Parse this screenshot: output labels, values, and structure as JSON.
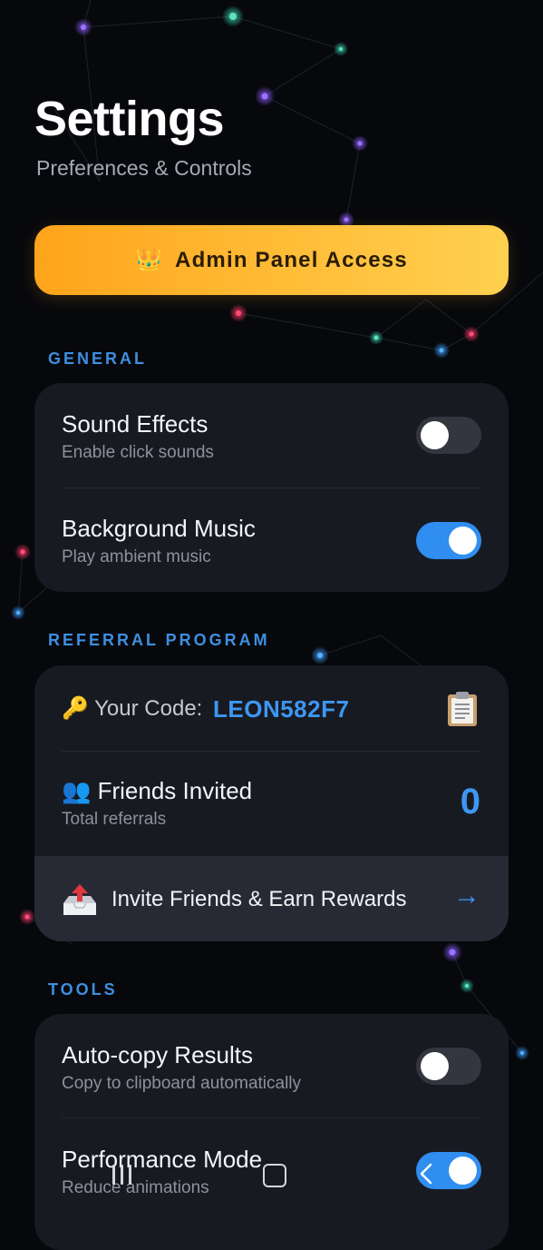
{
  "header": {
    "title": "Settings",
    "subtitle": "Preferences & Controls"
  },
  "admin": {
    "icon": "crown-icon",
    "emoji": "👑",
    "label": "Admin Panel Access"
  },
  "sections": {
    "general": "GENERAL",
    "referral": "REFERRAL PROGRAM",
    "tools": "TOOLS"
  },
  "general": {
    "sound": {
      "title": "Sound Effects",
      "subtitle": "Enable click sounds",
      "enabled": false
    },
    "music": {
      "title": "Background Music",
      "subtitle": "Play ambient music",
      "enabled": true
    }
  },
  "referral": {
    "code_icon": "key-icon",
    "code_emoji": "🔑",
    "code_label": "Your Code:",
    "code_value": "LEON582F7",
    "copy_icon": "clipboard-icon",
    "friends_icon": "people-icon",
    "friends_emoji": "👥",
    "friends_title": "Friends Invited",
    "friends_subtitle": "Total referrals",
    "friends_count": "0",
    "invite_icon": "outbox-tray-icon",
    "invite_label": "Invite Friends & Earn Rewards",
    "invite_arrow": "→"
  },
  "tools": {
    "autocopy": {
      "title": "Auto-copy Results",
      "subtitle": "Copy to clipboard automatically",
      "enabled": false
    },
    "performance": {
      "title": "Performance Mode",
      "subtitle": "Reduce animations",
      "enabled": true
    }
  },
  "colors": {
    "accent": "#3d97f2",
    "gold_start": "#ffa41a",
    "gold_end": "#ffd04f",
    "card": "#181a22",
    "background": "#07080c"
  },
  "system_nav": {
    "recents_icon": "recents-icon",
    "home_icon": "home-icon",
    "back_icon": "back-chevron-icon"
  }
}
